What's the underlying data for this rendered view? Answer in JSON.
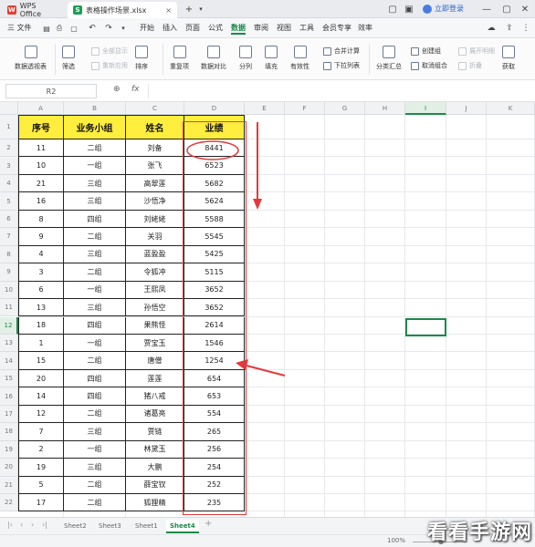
{
  "titlebar": {
    "app_tab": "WPS Office",
    "file_tab": "表格操作场景.xlsx",
    "close_glyph": "×",
    "new_tab_glyph": "+",
    "login": "立即登录"
  },
  "menu": {
    "file": "三 文件",
    "items": [
      "开始",
      "插入",
      "页面",
      "公式",
      "数据",
      "审阅",
      "视图",
      "工具",
      "会员专享",
      "效率"
    ],
    "active": "数据"
  },
  "ribbon": {
    "pivot": "数据透视表",
    "filter": "筛选",
    "show_all": "全部显示",
    "reapply": "重新应用",
    "sort": "排序",
    "duplicates": "重复项",
    "compare": "数据对比",
    "split": "分列",
    "fill": "填充",
    "validity": "有效性",
    "dropdown": "下拉列表",
    "consolidate": "合并计算",
    "subtotal": "分类汇总",
    "create_group": "创建组",
    "ungroup": "取消组合",
    "expand": "展开明细",
    "collapse": "折叠",
    "get": "获取"
  },
  "formula_bar": {
    "cell_ref": "R2",
    "zoom_icon": "⊕",
    "fx": "fx",
    "content": ""
  },
  "columns": [
    "A",
    "B",
    "C",
    "D",
    "E",
    "F",
    "G",
    "H",
    "I",
    "J",
    "K"
  ],
  "selected_column": "I",
  "selected_row": 12,
  "rows": [
    "1",
    "2",
    "3",
    "4",
    "5",
    "6",
    "7",
    "8",
    "9",
    "10",
    "11",
    "12",
    "13",
    "14",
    "15",
    "16",
    "17",
    "18",
    "19",
    "20",
    "21",
    "22"
  ],
  "table": {
    "headers": [
      "序号",
      "业务小组",
      "姓名",
      "业绩"
    ],
    "data": [
      [
        "11",
        "二组",
        "刘备",
        "8441"
      ],
      [
        "10",
        "一组",
        "张飞",
        "6523"
      ],
      [
        "21",
        "三组",
        "高翠莲",
        "5682"
      ],
      [
        "16",
        "三组",
        "沙悟净",
        "5624"
      ],
      [
        "8",
        "四组",
        "刘姥姥",
        "5588"
      ],
      [
        "9",
        "二组",
        "关羽",
        "5545"
      ],
      [
        "4",
        "三组",
        "蓝盈盈",
        "5425"
      ],
      [
        "3",
        "二组",
        "令狐冲",
        "5115"
      ],
      [
        "6",
        "一组",
        "王熙凤",
        "3652"
      ],
      [
        "13",
        "三组",
        "孙悟空",
        "3652"
      ],
      [
        "18",
        "四组",
        "果熊怪",
        "2614"
      ],
      [
        "1",
        "一组",
        "贾宝玉",
        "1546"
      ],
      [
        "15",
        "二组",
        "唐僧",
        "1254"
      ],
      [
        "20",
        "四组",
        "莲莲",
        "654"
      ],
      [
        "14",
        "四组",
        "猪八戒",
        "653"
      ],
      [
        "12",
        "二组",
        "诸葛亮",
        "554"
      ],
      [
        "7",
        "三组",
        "贾链",
        "265"
      ],
      [
        "2",
        "一组",
        "林黛玉",
        "256"
      ],
      [
        "19",
        "三组",
        "大鹏",
        "254"
      ],
      [
        "5",
        "二组",
        "薛宝钗",
        "252"
      ],
      [
        "17",
        "二组",
        "狐狸精",
        "235"
      ]
    ]
  },
  "sheets": [
    "Sheet2",
    "Sheet3",
    "Sheet1",
    "Sheet4"
  ],
  "active_sheet": "Sheet4",
  "status": {
    "zoom": "100%"
  },
  "watermark": "看看手游网",
  "colors": {
    "header_fill": "#ffee3d",
    "accent": "#1a8a48",
    "annotation": "#e23a3a"
  }
}
